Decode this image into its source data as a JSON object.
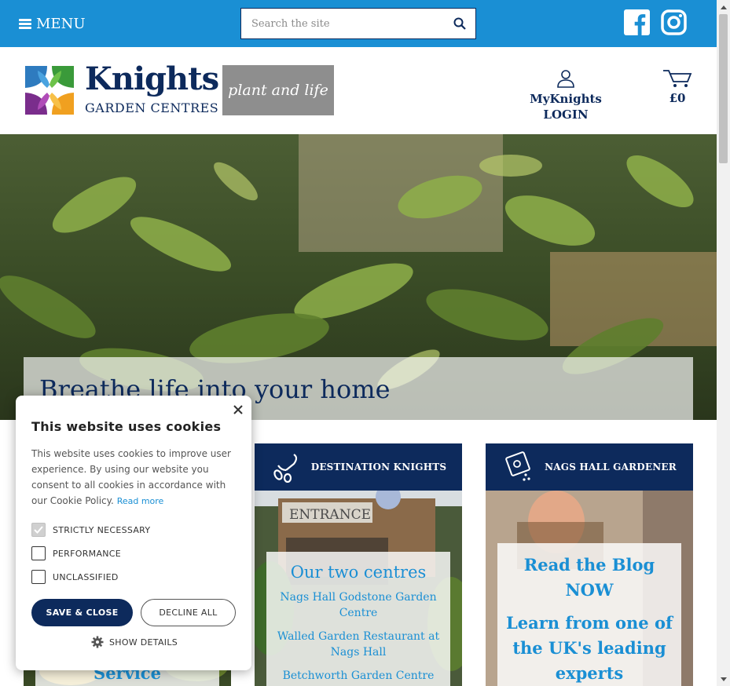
{
  "topbar": {
    "menu_label": "MENU",
    "search_placeholder": "Search the site",
    "brand_color": "#1a8fd4"
  },
  "header": {
    "logo_line1": "Knights",
    "logo_line2": "GARDEN CENTRES",
    "partner_logo": "plant and life",
    "account_line1": "MyKnights",
    "account_line2": "LOGIN",
    "cart_total": "£0"
  },
  "hero": {
    "caption": "Breathe life into your home"
  },
  "cards": {
    "service_title": "Service",
    "destination": {
      "header": "DESTINATION KNIGHTS",
      "title": "Our two centres",
      "links": [
        "Nags Hall Godstone Garden Centre",
        "Walled Garden Restaurant at Nags Hall",
        "Betchworth Garden Centre"
      ]
    },
    "blog": {
      "header": "NAGS HALL GARDENER",
      "text1": "Read the Blog NOW",
      "text2": "Learn from one of the UK's leading experts"
    }
  },
  "cookie": {
    "title": "This website uses cookies",
    "body": "This website uses cookies to improve user experience. By using our website you consent to all cookies in accordance with our Cookie Policy.",
    "read_more": "Read more",
    "options": [
      {
        "label": "STRICTLY NECESSARY",
        "checked": true
      },
      {
        "label": "PERFORMANCE",
        "checked": false
      },
      {
        "label": "UNCLASSIFIED",
        "checked": false
      }
    ],
    "save_label": "SAVE & CLOSE",
    "decline_label": "DECLINE ALL",
    "details_label": "SHOW DETAILS"
  },
  "colors": {
    "navy": "#0d2a5c",
    "blue": "#1a8fd4",
    "grey_logo": "#8e8e8e"
  }
}
